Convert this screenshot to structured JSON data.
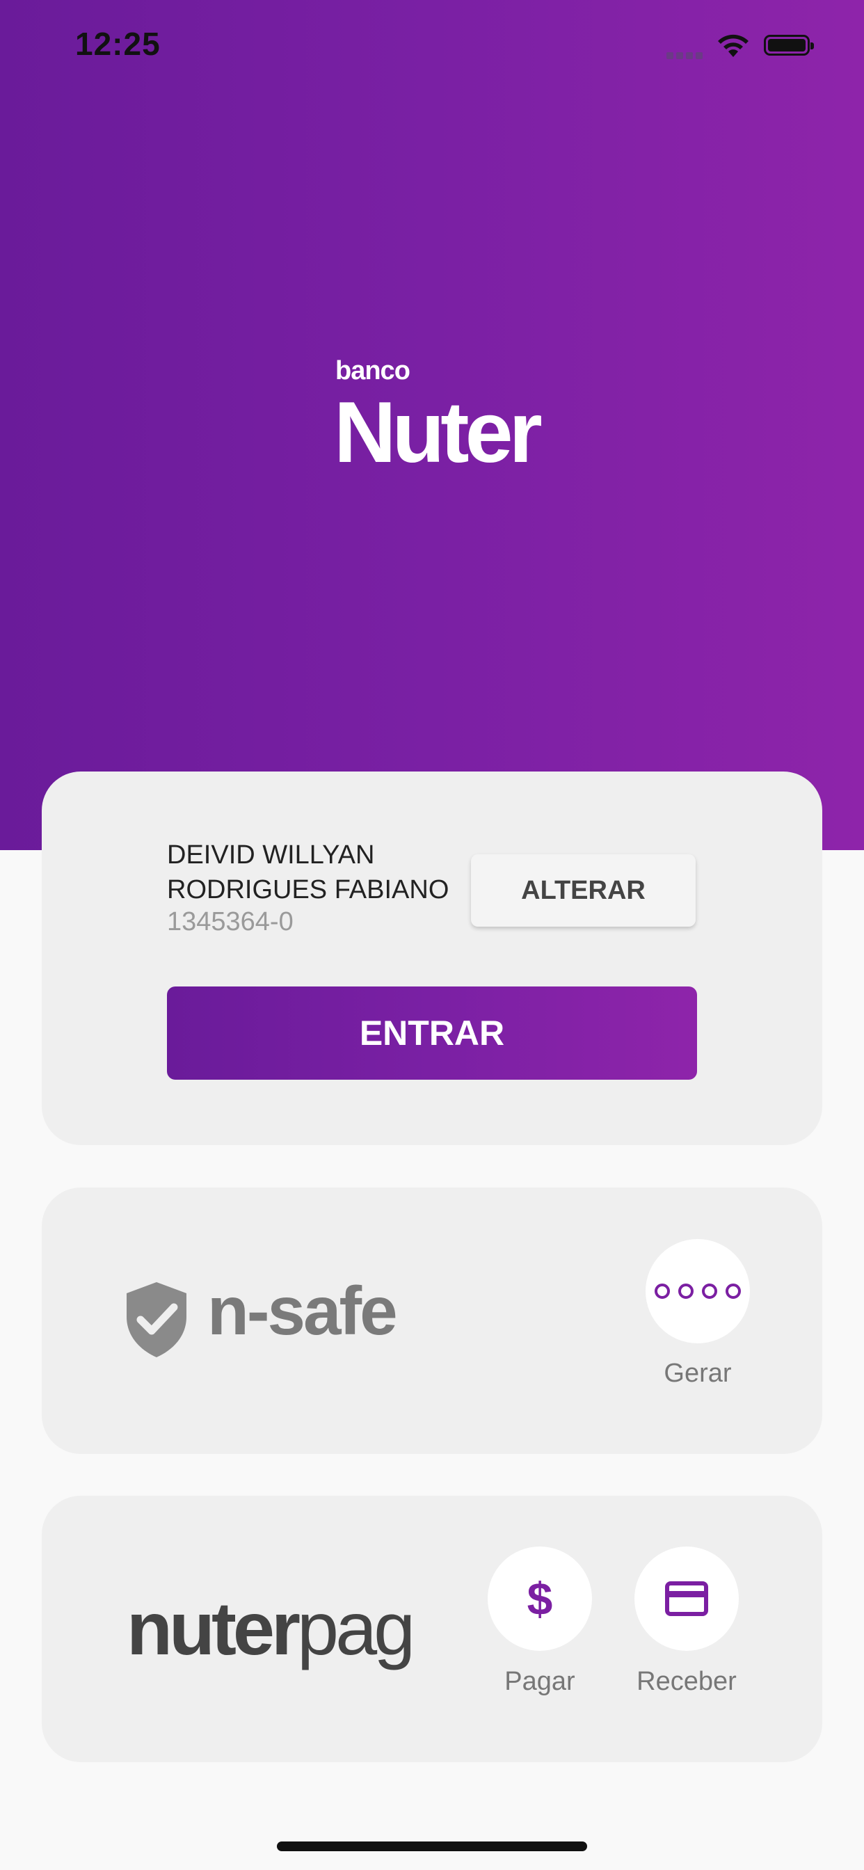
{
  "status_bar": {
    "time": "12:25"
  },
  "header": {
    "brand_prefix": "banco",
    "brand_name": "Nuter"
  },
  "login_card": {
    "user_name_line1": "DEIVID WILLYAN",
    "user_name_line2": "RODRIGUES FABIANO",
    "account_number": "1345364-0",
    "change_button": "ALTERAR",
    "enter_button": "ENTRAR"
  },
  "nsafe_card": {
    "logo_text": "n-safe",
    "generate_label": "Gerar"
  },
  "nuterpag_card": {
    "logo_bold": "nuter",
    "logo_light": "pag",
    "pay_label": "Pagar",
    "pay_icon_glyph": "$",
    "receive_label": "Receber"
  },
  "colors": {
    "primary": "#7b1fa2",
    "gradient_start": "#6a1b9a",
    "gradient_end": "#8e24aa"
  }
}
